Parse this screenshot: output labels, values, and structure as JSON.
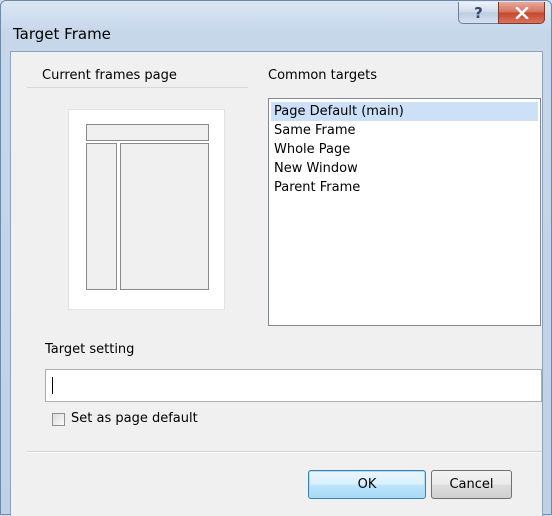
{
  "window": {
    "title": "Target Frame",
    "help_glyph": "?",
    "close_icon": "close-icon"
  },
  "frames_panel": {
    "label": "Current frames page"
  },
  "targets": {
    "label": "Common targets",
    "items": [
      {
        "label": "Page Default (main)",
        "selected": true
      },
      {
        "label": "Same Frame",
        "selected": false
      },
      {
        "label": "Whole Page",
        "selected": false
      },
      {
        "label": "New Window",
        "selected": false
      },
      {
        "label": "Parent Frame",
        "selected": false
      }
    ]
  },
  "target_setting": {
    "label": "Target setting",
    "value": ""
  },
  "page_default": {
    "label": "Set as page default",
    "checked": false
  },
  "buttons": {
    "ok": "OK",
    "cancel": "Cancel"
  }
}
